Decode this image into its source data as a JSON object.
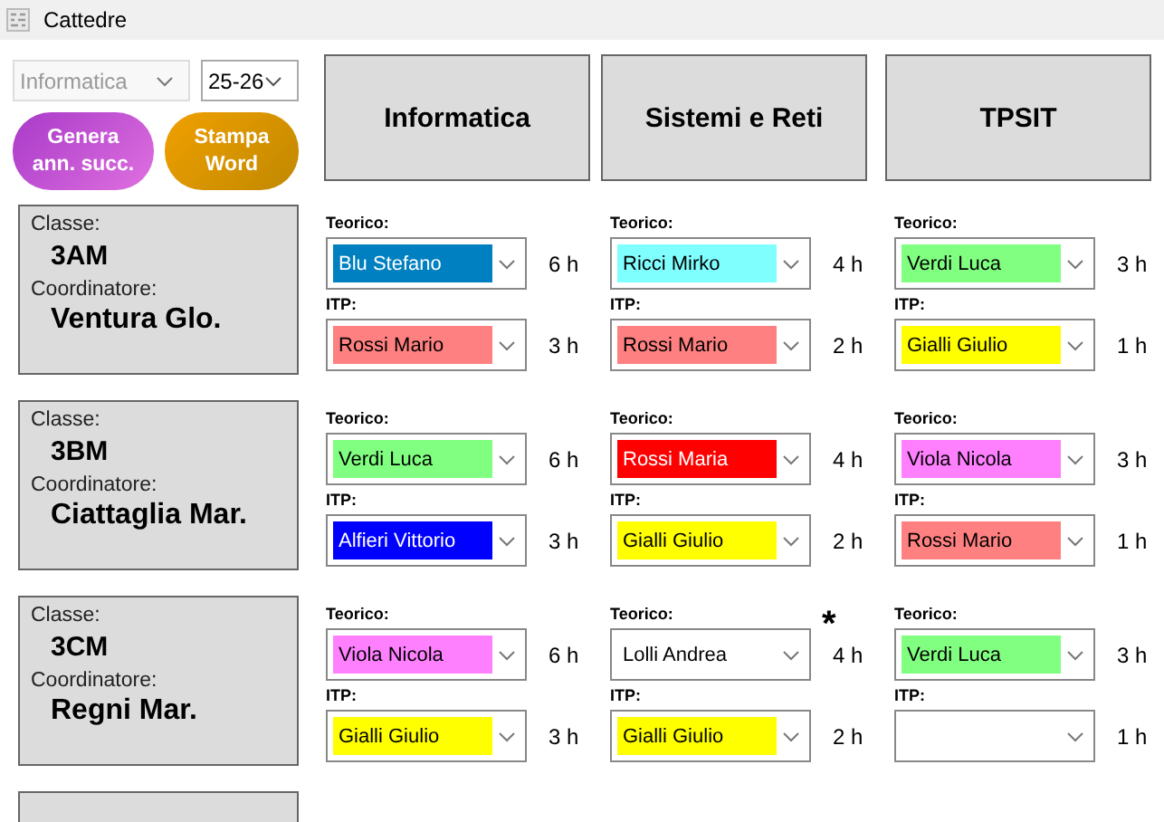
{
  "window": {
    "title": "Cattedre"
  },
  "toolbar": {
    "subject_select": {
      "value": "Informatica",
      "disabled": true
    },
    "year_select": {
      "value": "25-26",
      "disabled": false
    },
    "buttons": [
      {
        "label": "Genera ann. succ.",
        "kind": "generate"
      },
      {
        "label": "Stampa Word",
        "kind": "print"
      }
    ]
  },
  "subjects": [
    "Informatica",
    "Sistemi e Reti",
    "TPSIT"
  ],
  "classes": [
    {
      "class_label": "Classe:",
      "name": "3AM",
      "coordinator_label": "Coordinatore:",
      "coordinator": "Ventura Glo.",
      "assignments": [
        {
          "theory": {
            "label": "Teorico:",
            "teacher": "Blu Stefano",
            "color": "#0080c0",
            "hours": "6 h"
          },
          "itp": {
            "label": "ITP:",
            "teacher": "Rossi Mario",
            "color": "#ff8080",
            "hours": "3 h"
          }
        },
        {
          "theory": {
            "label": "Teorico:",
            "teacher": "Ricci Mirko",
            "color": "#80ffff",
            "hours": "4 h"
          },
          "itp": {
            "label": "ITP:",
            "teacher": "Rossi Mario",
            "color": "#ff8080",
            "hours": "2 h"
          }
        },
        {
          "theory": {
            "label": "Teorico:",
            "teacher": "Verdi Luca",
            "color": "#80ff80",
            "hours": "3 h"
          },
          "itp": {
            "label": "ITP:",
            "teacher": "Gialli Giulio",
            "color": "#ffff00",
            "hours": "1 h"
          }
        }
      ]
    },
    {
      "class_label": "Classe:",
      "name": "3BM",
      "coordinator_label": "Coordinatore:",
      "coordinator": "Ciattaglia Mar.",
      "assignments": [
        {
          "theory": {
            "label": "Teorico:",
            "teacher": "Verdi Luca",
            "color": "#80ff80",
            "hours": "6 h"
          },
          "itp": {
            "label": "ITP:",
            "teacher": "Alfieri Vittorio",
            "color": "#0000ff",
            "hours": "3 h"
          }
        },
        {
          "theory": {
            "label": "Teorico:",
            "teacher": "Rossi Maria",
            "color": "#ff0000",
            "hours": "4 h"
          },
          "itp": {
            "label": "ITP:",
            "teacher": "Gialli Giulio",
            "color": "#ffff00",
            "hours": "2 h"
          }
        },
        {
          "theory": {
            "label": "Teorico:",
            "teacher": "Viola Nicola",
            "color": "#ff80ff",
            "hours": "3 h"
          },
          "itp": {
            "label": "ITP:",
            "teacher": "Rossi Mario",
            "color": "#ff8080",
            "hours": "1 h"
          }
        }
      ]
    },
    {
      "class_label": "Classe:",
      "name": "3CM",
      "coordinator_label": "Coordinatore:",
      "coordinator": "Regni Mar.",
      "assignments": [
        {
          "theory": {
            "label": "Teorico:",
            "teacher": "Viola Nicola",
            "color": "#ff80ff",
            "hours": "6 h"
          },
          "itp": {
            "label": "ITP:",
            "teacher": "Gialli Giulio",
            "color": "#ffff00",
            "hours": "3 h"
          }
        },
        {
          "theory": {
            "label": "Teorico:",
            "teacher": "Lolli Andrea",
            "hours": "4 h",
            "note": "*"
          },
          "itp": {
            "label": "ITP:",
            "teacher": "Gialli Giulio",
            "color": "#ffff00",
            "hours": "2 h"
          }
        },
        {
          "theory": {
            "label": "Teorico:",
            "teacher": "Verdi Luca",
            "color": "#80ff80",
            "hours": "3 h"
          },
          "itp": {
            "label": "ITP:",
            "hours": "1 h"
          }
        }
      ]
    }
  ]
}
